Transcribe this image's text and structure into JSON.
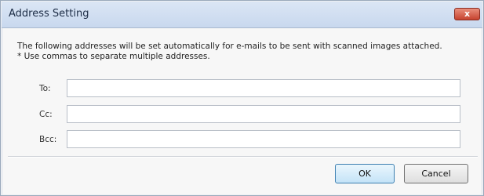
{
  "window": {
    "title": "Address Setting",
    "close_glyph": "x"
  },
  "description": {
    "line1": "The following addresses will be set automatically for e-mails to be sent with scanned images attached.",
    "line2": "* Use commas to separate multiple addresses."
  },
  "fields": {
    "to": {
      "label": "To:",
      "value": ""
    },
    "cc": {
      "label": "Cc:",
      "value": ""
    },
    "bcc": {
      "label": "Bcc:",
      "value": ""
    }
  },
  "buttons": {
    "ok": "OK",
    "cancel": "Cancel"
  }
}
